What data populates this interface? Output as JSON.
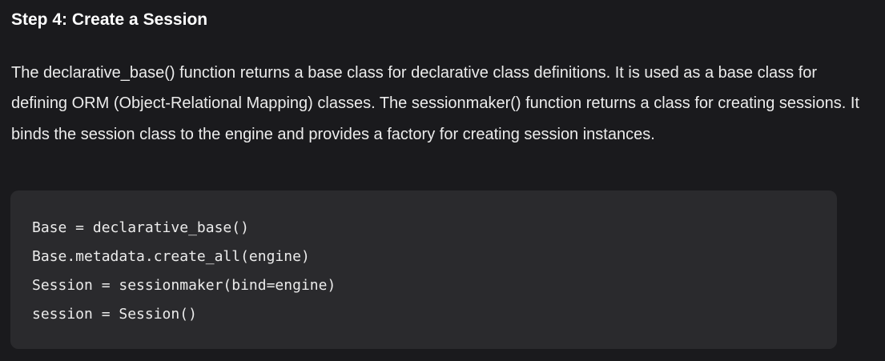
{
  "heading": "Step 4: Create a Session",
  "paragraph": "The declarative_base() function returns a base class for declarative class definitions. It is used as a base class for defining ORM (Object-Relational Mapping) classes. The sessionmaker() function returns a class for creating sessions. It binds the session class to the engine and provides a factory for creating session instances.",
  "code": {
    "lines": [
      "Base = declarative_base()",
      "Base.metadata.create_all(engine)",
      "Session = sessionmaker(bind=engine)",
      "session = Session()"
    ]
  },
  "colors": {
    "background": "#1a1a1d",
    "code_background": "#2a2a2d",
    "text": "#ececec"
  }
}
